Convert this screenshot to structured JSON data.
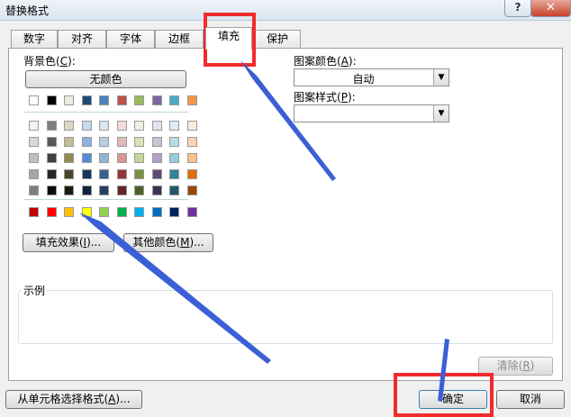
{
  "window": {
    "title": "替换格式",
    "help": "?",
    "close": "✕"
  },
  "tabs": [
    {
      "label": "数字"
    },
    {
      "label": "对齐"
    },
    {
      "label": "字体"
    },
    {
      "label": "边框"
    },
    {
      "label": "填充"
    },
    {
      "label": "保护"
    }
  ],
  "background": {
    "label": "背景色",
    "accel": "C",
    "no_color_button": "无颜色",
    "fill_effects_button": "填充效果",
    "fill_effects_accel": "I",
    "more_colors_button": "其他颜色",
    "more_colors_accel": "M",
    "row1": [
      "#ffffff",
      "#000000",
      "#eeece1",
      "#1f497d",
      "#4f81bd",
      "#c0504d",
      "#9bbb59",
      "#8064a2",
      "#4bacc6",
      "#f79646"
    ],
    "grid": [
      [
        "#f2f2f2",
        "#7f7f7f",
        "#ddd9c3",
        "#c6d9f0",
        "#dbe5f1",
        "#f2dcdb",
        "#ebf1dd",
        "#e5e0ec",
        "#dbeef3",
        "#fdeada"
      ],
      [
        "#d8d8d8",
        "#595959",
        "#c4bd97",
        "#8db3e2",
        "#b8cce4",
        "#e5b9b7",
        "#d7e3bc",
        "#ccc1d9",
        "#b7dde8",
        "#fbd5b5"
      ],
      [
        "#bfbfbf",
        "#3f3f3f",
        "#938953",
        "#548dd4",
        "#95b3d7",
        "#d99694",
        "#c3d69b",
        "#b2a2c7",
        "#92cddc",
        "#fac08f"
      ],
      [
        "#a5a5a5",
        "#262626",
        "#494429",
        "#17365d",
        "#366092",
        "#953734",
        "#76923c",
        "#5f497a",
        "#31859b",
        "#e36c09"
      ],
      [
        "#7f7f7f",
        "#0c0c0c",
        "#1d1b10",
        "#0f243e",
        "#244061",
        "#632423",
        "#4f6128",
        "#3f3151",
        "#205867",
        "#974806"
      ]
    ],
    "standard": [
      "#c00000",
      "#ff0000",
      "#ffc000",
      "#ffff00",
      "#92d050",
      "#00b050",
      "#00b0f0",
      "#0070c0",
      "#002060",
      "#7030a0"
    ]
  },
  "pattern": {
    "color_label": "图案颜色",
    "color_accel": "A",
    "color_value": "自动",
    "style_label": "图案样式",
    "style_accel": "P",
    "style_value": ""
  },
  "sample": {
    "label": "示例"
  },
  "buttons": {
    "clear": "清除",
    "clear_accel": "R",
    "from_cell": "从单元格选择格式",
    "from_cell_accel": "A",
    "ok": "确定",
    "cancel": "取消"
  },
  "annotation_color": "#f02b2b",
  "arrow_color": "#3b5fd6"
}
